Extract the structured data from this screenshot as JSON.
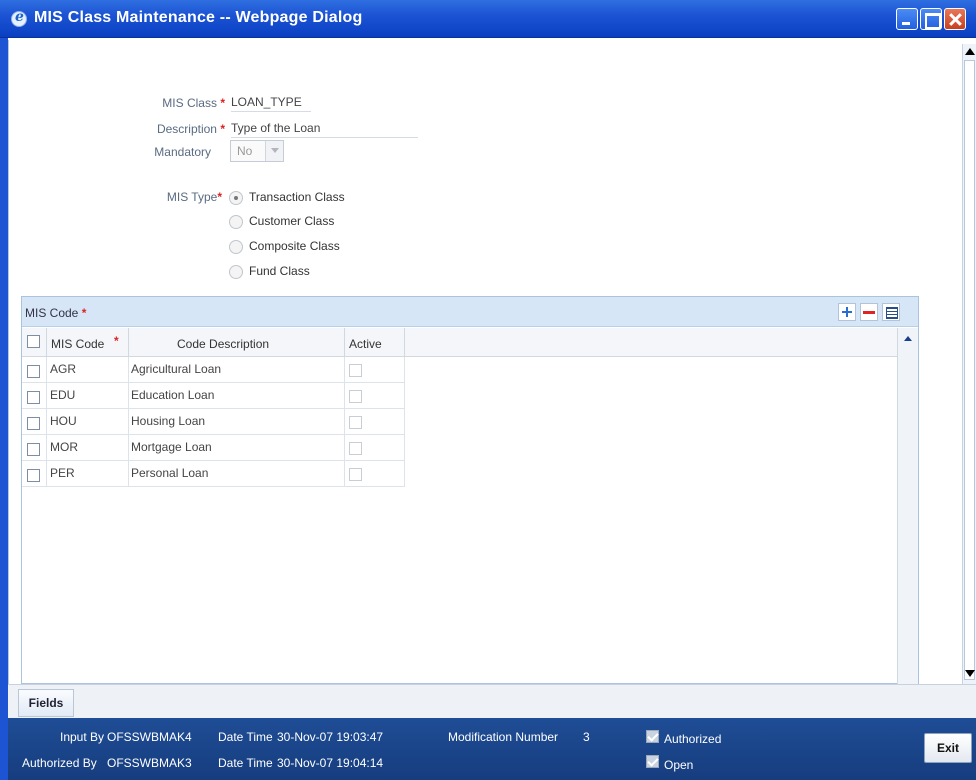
{
  "window": {
    "title": "MIS Class Maintenance -- Webpage Dialog"
  },
  "form": {
    "mis_class": {
      "label": "MIS Class",
      "required_mark": "*",
      "value": "LOAN_TYPE"
    },
    "description": {
      "label": "Description",
      "required_mark": "*",
      "value": "Type of the Loan"
    },
    "mandatory": {
      "label": "Mandatory",
      "selected": "No"
    },
    "mis_type": {
      "label": "MIS Type",
      "required_mark": "*",
      "selected_index": 0,
      "options": [
        "Transaction Class",
        "Customer Class",
        "Composite Class",
        "Fund Class"
      ]
    }
  },
  "grid": {
    "section_title": "MIS Code",
    "required_mark": "*",
    "columns": {
      "code": "MIS Code",
      "description": "Code Description",
      "active": "Active"
    },
    "rows": [
      {
        "code": "AGR",
        "description": "Agricultural Loan"
      },
      {
        "code": "EDU",
        "description": "Education Loan"
      },
      {
        "code": "HOU",
        "description": "Housing Loan"
      },
      {
        "code": "MOR",
        "description": "Mortgage Loan"
      },
      {
        "code": "PER",
        "description": "Personal Loan"
      }
    ]
  },
  "tabs": {
    "fields": "Fields"
  },
  "footer": {
    "input_by_label": "Input By",
    "input_by": "OFSSWBMAK4",
    "date_time_label": "Date Time",
    "input_date_time": "30-Nov-07 19:03:47",
    "authorized_by_label": "Authorized By",
    "authorized_by": "OFSSWBMAK3",
    "authorized_date_time": "30-Nov-07 19:04:14",
    "modification_number_label": "Modification Number",
    "modification_number": "3",
    "authorized_label": "Authorized",
    "open_label": "Open",
    "exit_label": "Exit"
  }
}
